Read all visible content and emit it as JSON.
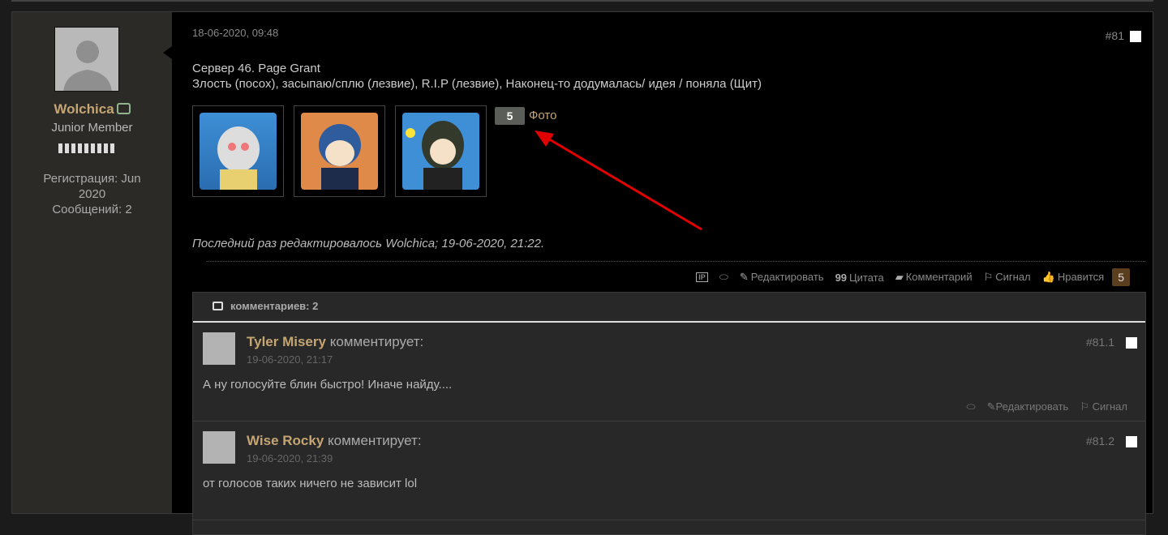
{
  "author": {
    "name": "Wolchica",
    "rank": "Junior Member",
    "registration": "Регистрация: Jun 2020",
    "posts": "Сообщений: 2"
  },
  "post": {
    "date": "18-06-2020, 09:48",
    "number": "#81",
    "line1": "Сервер 46. Page Grant",
    "line2": "Злость (посох), засыпаю/сплю (лезвие), R.I.P (лезвие), Наконец-то додумалась/ идея / поняла (Щит)",
    "photo_count": "5",
    "photo_label": "Фото",
    "edited": "Последний раз редактировалось Wolchica; 19-06-2020, 21:22.",
    "actions": {
      "edit": "Редактировать",
      "quote": "Цитата",
      "comment": "Комментарий",
      "report": "Сигнал",
      "like": "Нравится",
      "like_count": "5"
    }
  },
  "comments": {
    "header": "комментариев: 2",
    "verb": "комментирует:",
    "items": [
      {
        "name": "Tyler Misery",
        "date": "19-06-2020, 21:17",
        "text": "А ну голосуйте блин быстро! Иначе найду....",
        "number": "#81.1",
        "edit": "Редактировать",
        "report": "Сигнал"
      },
      {
        "name": "Wise Rocky",
        "date": "19-06-2020, 21:39",
        "text": "от голосов таких ничего не зависит lol",
        "number": "#81.2"
      }
    ]
  },
  "colors": {
    "username": "#c5a572",
    "like_badge": "#5b3e1d",
    "annotation_arrow": "#e00000"
  }
}
